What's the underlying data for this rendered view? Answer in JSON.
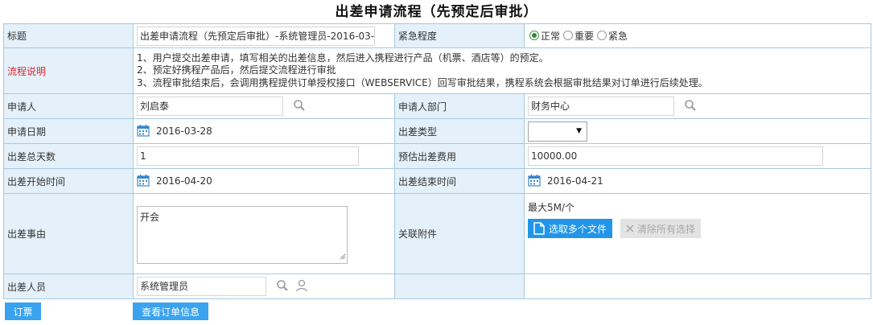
{
  "title": "出差申请流程（先预定后审批）",
  "rows": {
    "title_label": "标题",
    "title_value": "出差申请流程（先预定后审批）-系统管理员-2016-03-",
    "urgency_label": "紧急程度",
    "urgency_options": [
      "正常",
      "重要",
      "紧急"
    ],
    "urgency_selected": "正常",
    "process_label": "流程说明",
    "process_desc": [
      "1、用户提交出差申请，填写相关的出差信息，然后进入携程进行产品（机票、酒店等）的预定。",
      "2、预定好携程产品后，然后提交流程进行审批",
      "3、流程审批结束后，会调用携程提供订单授权接口（WEBSERVICE）回写审批结果，携程系统会根据审批结果对订单进行后续处理。"
    ],
    "applicant_label": "申请人",
    "applicant_value": "刘启泰",
    "dept_label": "申请人部门",
    "dept_value": "财务中心",
    "apply_date_label": "申请日期",
    "apply_date_value": "2016-03-28",
    "trip_type_label": "出差类型",
    "trip_type_value": "",
    "days_label": "出差总天数",
    "days_value": "1",
    "cost_label": "预估出差费用",
    "cost_value": "10000.00",
    "start_label": "出差开始时间",
    "start_value": "2016-04-20",
    "end_label": "出差结束时间",
    "end_value": "2016-04-21",
    "reason_label": "出差事由",
    "reason_value": "开会",
    "attach_label": "关联附件",
    "attach_note": "最大5M/个",
    "attach_select_btn": "选取多个文件",
    "attach_clear_btn": "清除所有选择",
    "traveler_label": "出差人员",
    "traveler_value": "系统管理员"
  },
  "bottom_buttons": {
    "book": "订票",
    "view_orders": "查看订单信息"
  },
  "icons": {
    "search": "search-icon",
    "person": "person-icon",
    "calendar": "calendar-icon",
    "file": "file-icon",
    "close": "close-icon",
    "dropdown": "dropdown-arrow-icon"
  },
  "colors": {
    "label_bg": "#e4f1fa",
    "border": "#a8c8e0",
    "desc_red": "#d9262c",
    "button_blue": "#2196e8"
  }
}
